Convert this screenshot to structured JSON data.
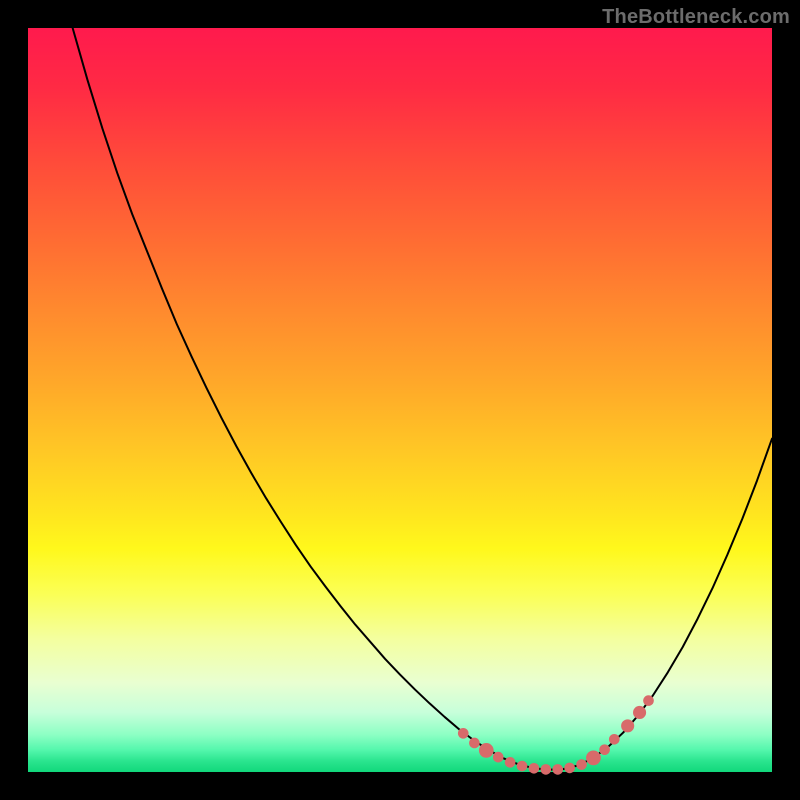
{
  "watermark": "TheBottleneck.com",
  "colors": {
    "curve": "#000000",
    "marker_fill": "#d86a6a",
    "marker_stroke": "#d86a6a"
  },
  "chart_data": {
    "type": "line",
    "title": "",
    "xlabel": "",
    "ylabel": "",
    "xlim": [
      0,
      100
    ],
    "ylim": [
      0,
      100
    ],
    "grid": false,
    "legend": false,
    "note": "V-shaped bottleneck curve. y-values are percent of plot height from bottom; x-values are percent of plot width from left. Values estimated from pixel positions; no axis ticks present.",
    "series": [
      {
        "name": "bottleneck-curve",
        "x": [
          6,
          8,
          10,
          12,
          14,
          16,
          18,
          20,
          22,
          24,
          26,
          28,
          30,
          32,
          34,
          36,
          38,
          40,
          42,
          44,
          46,
          48,
          50,
          52,
          54,
          56,
          58,
          60,
          62,
          64,
          66,
          68,
          70,
          72,
          74,
          76,
          78,
          80,
          82,
          84,
          86,
          88,
          90,
          92,
          94,
          96,
          98,
          100
        ],
        "y": [
          100,
          93,
          86.5,
          80.5,
          75,
          70,
          65,
          60.2,
          55.8,
          51.6,
          47.6,
          43.8,
          40.2,
          36.8,
          33.6,
          30.5,
          27.6,
          24.9,
          22.3,
          19.8,
          17.5,
          15.2,
          13.1,
          11.1,
          9.2,
          7.4,
          5.7,
          4.2,
          2.9,
          1.8,
          1.0,
          0.5,
          0.3,
          0.4,
          0.9,
          1.9,
          3.4,
          5.3,
          7.6,
          10.3,
          13.4,
          16.8,
          20.6,
          24.7,
          29.2,
          34.0,
          39.2,
          44.8
        ]
      }
    ],
    "markers": {
      "name": "highlight-dots",
      "note": "Pink rounded markers clustered near curve minimum plus a few on the ascending branch.",
      "points": [
        {
          "x": 58.5,
          "y": 5.2,
          "r": 1.3
        },
        {
          "x": 60.0,
          "y": 3.9,
          "r": 1.3
        },
        {
          "x": 61.6,
          "y": 2.9,
          "r": 1.8
        },
        {
          "x": 63.2,
          "y": 2.0,
          "r": 1.3
        },
        {
          "x": 64.8,
          "y": 1.3,
          "r": 1.3
        },
        {
          "x": 66.4,
          "y": 0.8,
          "r": 1.3
        },
        {
          "x": 68.0,
          "y": 0.5,
          "r": 1.3
        },
        {
          "x": 69.6,
          "y": 0.35,
          "r": 1.3
        },
        {
          "x": 71.2,
          "y": 0.35,
          "r": 1.3
        },
        {
          "x": 72.8,
          "y": 0.55,
          "r": 1.3
        },
        {
          "x": 74.4,
          "y": 1.0,
          "r": 1.3
        },
        {
          "x": 76.0,
          "y": 1.9,
          "r": 1.8
        },
        {
          "x": 77.5,
          "y": 3.0,
          "r": 1.3
        },
        {
          "x": 78.8,
          "y": 4.4,
          "r": 1.3
        },
        {
          "x": 80.6,
          "y": 6.2,
          "r": 1.6
        },
        {
          "x": 82.2,
          "y": 8.0,
          "r": 1.6
        },
        {
          "x": 83.4,
          "y": 9.6,
          "r": 1.3
        }
      ]
    }
  }
}
